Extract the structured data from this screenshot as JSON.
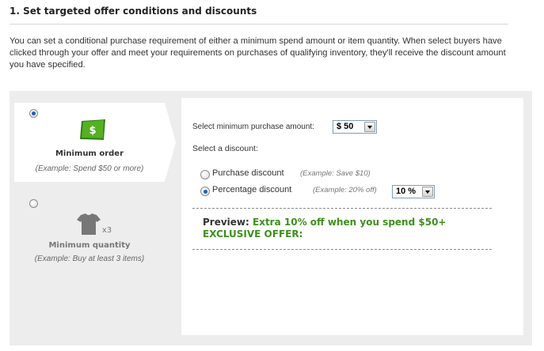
{
  "section": {
    "heading": "1. Set targeted offer conditions and discounts",
    "intro": "You can set a conditional purchase requirement of either a minimum spend amount or item quantity. When select buyers have clicked through your offer and meet your requirements on purchases of qualifying inventory, they'll receive the discount amount you have specified."
  },
  "condition_types": {
    "minimum_order": {
      "title": "Minimum order",
      "example": "(Example: Spend $50 or more)",
      "icon": "money-icon",
      "icon_symbol": "$",
      "selected": true
    },
    "minimum_quantity": {
      "title": "Minimum quantity",
      "example": "(Example: Buy at least 3 items)",
      "icon": "tshirt-icon",
      "icon_symbol": "x3",
      "selected": false
    }
  },
  "settings": {
    "min_purchase_label": "Select minimum purchase amount:",
    "min_purchase_value": "$ 50",
    "select_discount_label": "Select a discount:",
    "discount_options": [
      {
        "label": "Purchase discount",
        "example": "(Example: Save $10)",
        "selected": false
      },
      {
        "label": "Percentage discount",
        "example": "(Example: 20% off)",
        "selected": true
      }
    ],
    "percentage_value": "10 %"
  },
  "preview": {
    "label": "Preview:",
    "text": "Extra 10% off when you spend $50+",
    "line2": "EXCLUSIVE OFFER:"
  },
  "colors": {
    "accent_green": "#3d8f1c",
    "panel_gray": "#ededed",
    "radio_selected": "#1b5fb8"
  }
}
